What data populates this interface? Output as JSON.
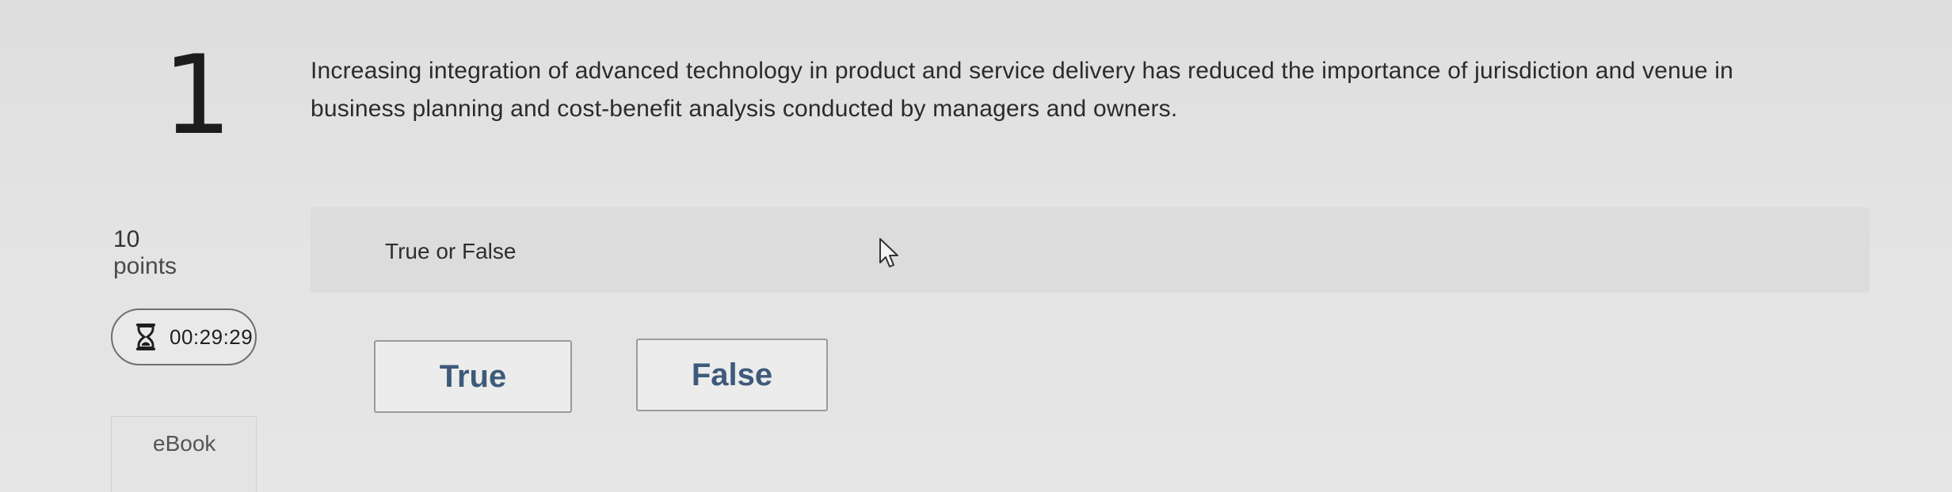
{
  "question": {
    "number": "1",
    "text": "Increasing integration of advanced technology in product and service delivery has reduced the importance of jurisdiction and venue in business planning and cost-benefit analysis conducted by managers and owners."
  },
  "points": {
    "value": "10",
    "label": "points"
  },
  "timer": {
    "icon": "hourglass-icon",
    "time": "00:29:29"
  },
  "sidebar": {
    "ebook_label": "eBook"
  },
  "prompt": {
    "label": "True or False"
  },
  "answers": {
    "true_label": "True",
    "false_label": "False"
  },
  "colors": {
    "answer_text": "#3e5a7a",
    "background": "#e3e3e3"
  }
}
